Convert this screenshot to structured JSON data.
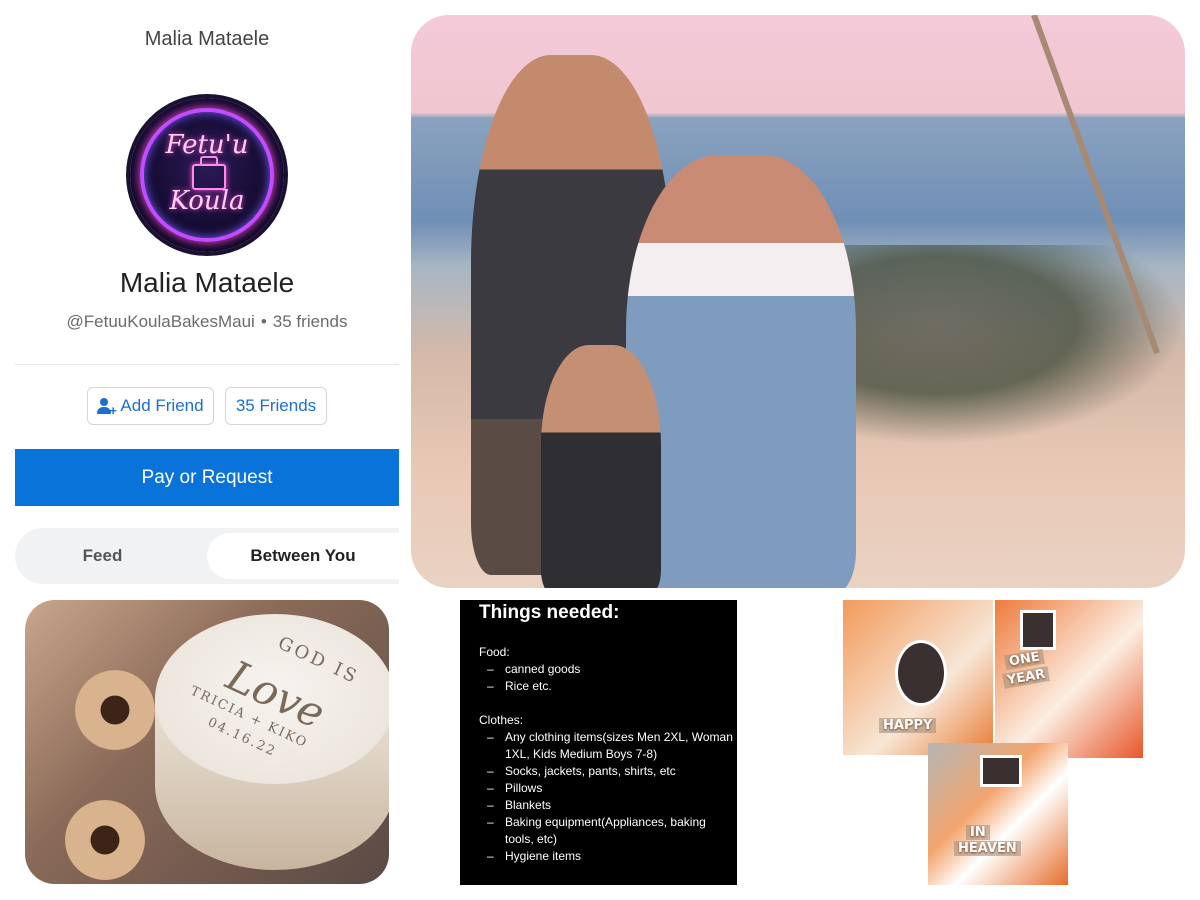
{
  "profile": {
    "top_name": "Malia Mataele",
    "avatar_text_line1": "Fetu'u",
    "avatar_text_line2": "Koula",
    "name": "Malia Mataele",
    "handle": "@FetuuKoulaBakesMaui",
    "separator": "•",
    "friends_count": "35 friends",
    "add_friend_label": "Add Friend",
    "friends_button_label": "35 Friends",
    "pay_label": "Pay or Request",
    "tabs": {
      "feed": "Feed",
      "between": "Between You"
    },
    "accent_color": "#0a73d9"
  },
  "cake_photo": {
    "god_is": "GOD IS",
    "love": "Love",
    "names": "TRICIA + KIKO",
    "date": "04.16.22"
  },
  "needs": {
    "title": "Things needed:",
    "food_heading": "Food:",
    "food_items": [
      "canned goods",
      "Rice etc."
    ],
    "clothes_heading": "Clothes:",
    "clothes_items": [
      "Any clothing items(sizes Men 2XL, Woman 1XL, Kids Medium Boys 7-8)",
      "Socks, jackets, pants, shirts, etc",
      "Pillows",
      "Blankets",
      "Baking equipment(Appliances, baking tools, etc)",
      "Hygiene items"
    ]
  },
  "collage": {
    "happy": "HAPPY",
    "one": "ONE",
    "year": "YEAR",
    "in": "IN",
    "heaven": "HEAVEN"
  }
}
